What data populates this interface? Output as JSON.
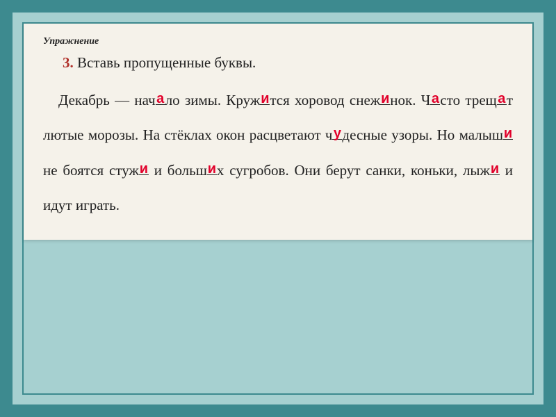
{
  "label": "Упражнение",
  "task": {
    "number": "3.",
    "title": "Вставь пропущенные буквы."
  },
  "text": {
    "w1a": "Декабрь — нач",
    "w1b": "ло зимы. Круж",
    "w1c": "тся хоровод снеж",
    "w1d": "нок. Ч",
    "w1e": "сто трещ",
    "w1f": "т лютые морозы. На стёклах окон расцветают ч",
    "w1g": "десные узоры. Но ма­лыш",
    "w1h": " не боятся стуж",
    "w1i": " и больш",
    "w1j": "х сугробов. Они берут санки, коньки, лыж",
    "w1k": " и идут играть."
  },
  "answers": {
    "a1": "а",
    "a2": "и",
    "a3": "и",
    "a4": "а",
    "a5": "а",
    "a6": "у",
    "a7": "и",
    "a8": "и",
    "a9": "и",
    "a10": "и"
  }
}
